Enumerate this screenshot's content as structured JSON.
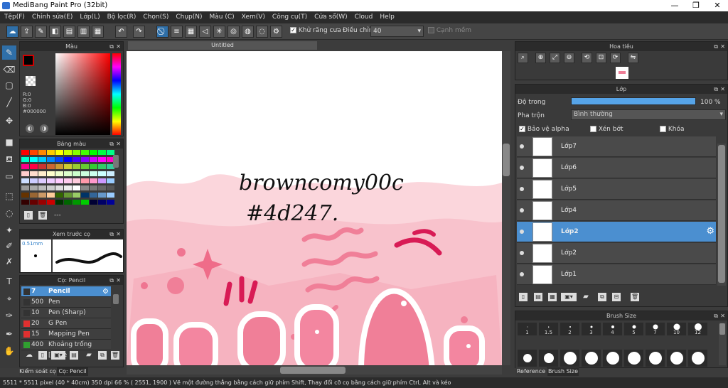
{
  "window": {
    "title": "MediBang Paint Pro (32bit)",
    "min": "—",
    "max": "❐",
    "close": "✕"
  },
  "menu": [
    "Tệp(F)",
    "Chỉnh sửa(E)",
    "Lớp(L)",
    "Bộ lọc(R)",
    "Chọn(S)",
    "Chụp(N)",
    "Màu (C)",
    "Xem(V)",
    "Công cụ(T)",
    "Cửa sổ(W)",
    "Cloud",
    "Help"
  ],
  "toolbar": {
    "antialias_label": "Khử răng cưa",
    "adjust_label": "Điều chỉnh",
    "adjust_value": "40",
    "snap_label": "Cạnh mềm"
  },
  "color_panel": {
    "title": "Màu",
    "r": "R:0",
    "g": "G:0",
    "b": "B:0",
    "hex": "#000000",
    "fg": "#000000",
    "bg": "#ffffff",
    "accent": "#d00000"
  },
  "palette_panel": {
    "title": "Bảng màu",
    "footer_text": "---"
  },
  "brush_preview_panel": {
    "title": "Xem trước cọ",
    "size": "0.51mm"
  },
  "brush_panel": {
    "title": "Cọ: Pencil",
    "items": [
      {
        "size": "7",
        "name": "Pencil",
        "color": "#333333"
      },
      {
        "size": "500",
        "name": "Pen",
        "color": "#333333"
      },
      {
        "size": "10",
        "name": "Pen (Sharp)",
        "color": "#333333"
      },
      {
        "size": "20",
        "name": "G Pen",
        "color": "#e03030"
      },
      {
        "size": "15",
        "name": "Mapping Pen",
        "color": "#e03030"
      },
      {
        "size": "400",
        "name": "Khoảng trống [Edge",
        "color": "#30a030"
      }
    ],
    "tabs": [
      "Kiểm soát cọ",
      "Cọ: Pencil"
    ]
  },
  "canvas": {
    "tab": "Untitled",
    "handwriting_1": "browncomy00c",
    "handwriting_2": "#4d247."
  },
  "navigator": {
    "title": "Hoa tiêu"
  },
  "layer_panel": {
    "title": "Lớp",
    "opacity_label": "Độ trong",
    "opacity_value": "100 %",
    "opacity_fraction": 1.0,
    "blend_label": "Pha trộn",
    "blend_value": "Bình thường",
    "protect_alpha": "Bảo vệ alpha",
    "clipping": "Xén bớt",
    "lock": "Khóa",
    "layers": [
      {
        "name": "Lớp7",
        "selected": false
      },
      {
        "name": "Lớp6",
        "selected": false
      },
      {
        "name": "Lớp5",
        "selected": false
      },
      {
        "name": "Lớp4",
        "selected": false
      },
      {
        "name": "Lớp2",
        "selected": true
      },
      {
        "name": "Lớp2",
        "selected": false
      },
      {
        "name": "Lớp1",
        "selected": false
      }
    ]
  },
  "brush_size_panel": {
    "title": "Brush Size",
    "sizes": [
      "1",
      "1.5",
      "2",
      "3",
      "4",
      "5",
      "7",
      "10",
      "12"
    ],
    "tabs": [
      "Reference",
      "Brush Size"
    ]
  },
  "status": "5511 * 5511 pixel  (40 * 40cm)  350 dpi  66 %  ( 2551, 1900 )  Vẽ một đường thẳng bằng cách giữ phím Shift, Thay đổi cỡ cọ bằng cách giữ phím Ctrl, Alt và kéo"
}
